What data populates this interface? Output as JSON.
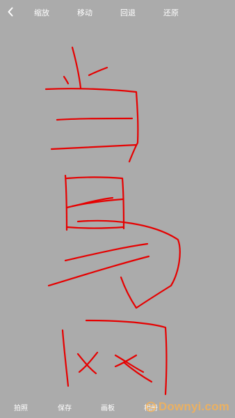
{
  "toolbar": {
    "back_icon": "chevron-left-icon",
    "zoom_label": "缩放",
    "move_label": "移动",
    "undo_label": "回退",
    "restore_label": "还原"
  },
  "bottom_bar": {
    "photo_label": "拍照",
    "save_label": "保存",
    "board_label": "画板",
    "album_label": "相册"
  },
  "watermark": {
    "text": "Downyi.com",
    "icon": "globe-logo-icon"
  },
  "drawing": {
    "stroke_color": "#e60000",
    "background_color": "#ababab"
  }
}
